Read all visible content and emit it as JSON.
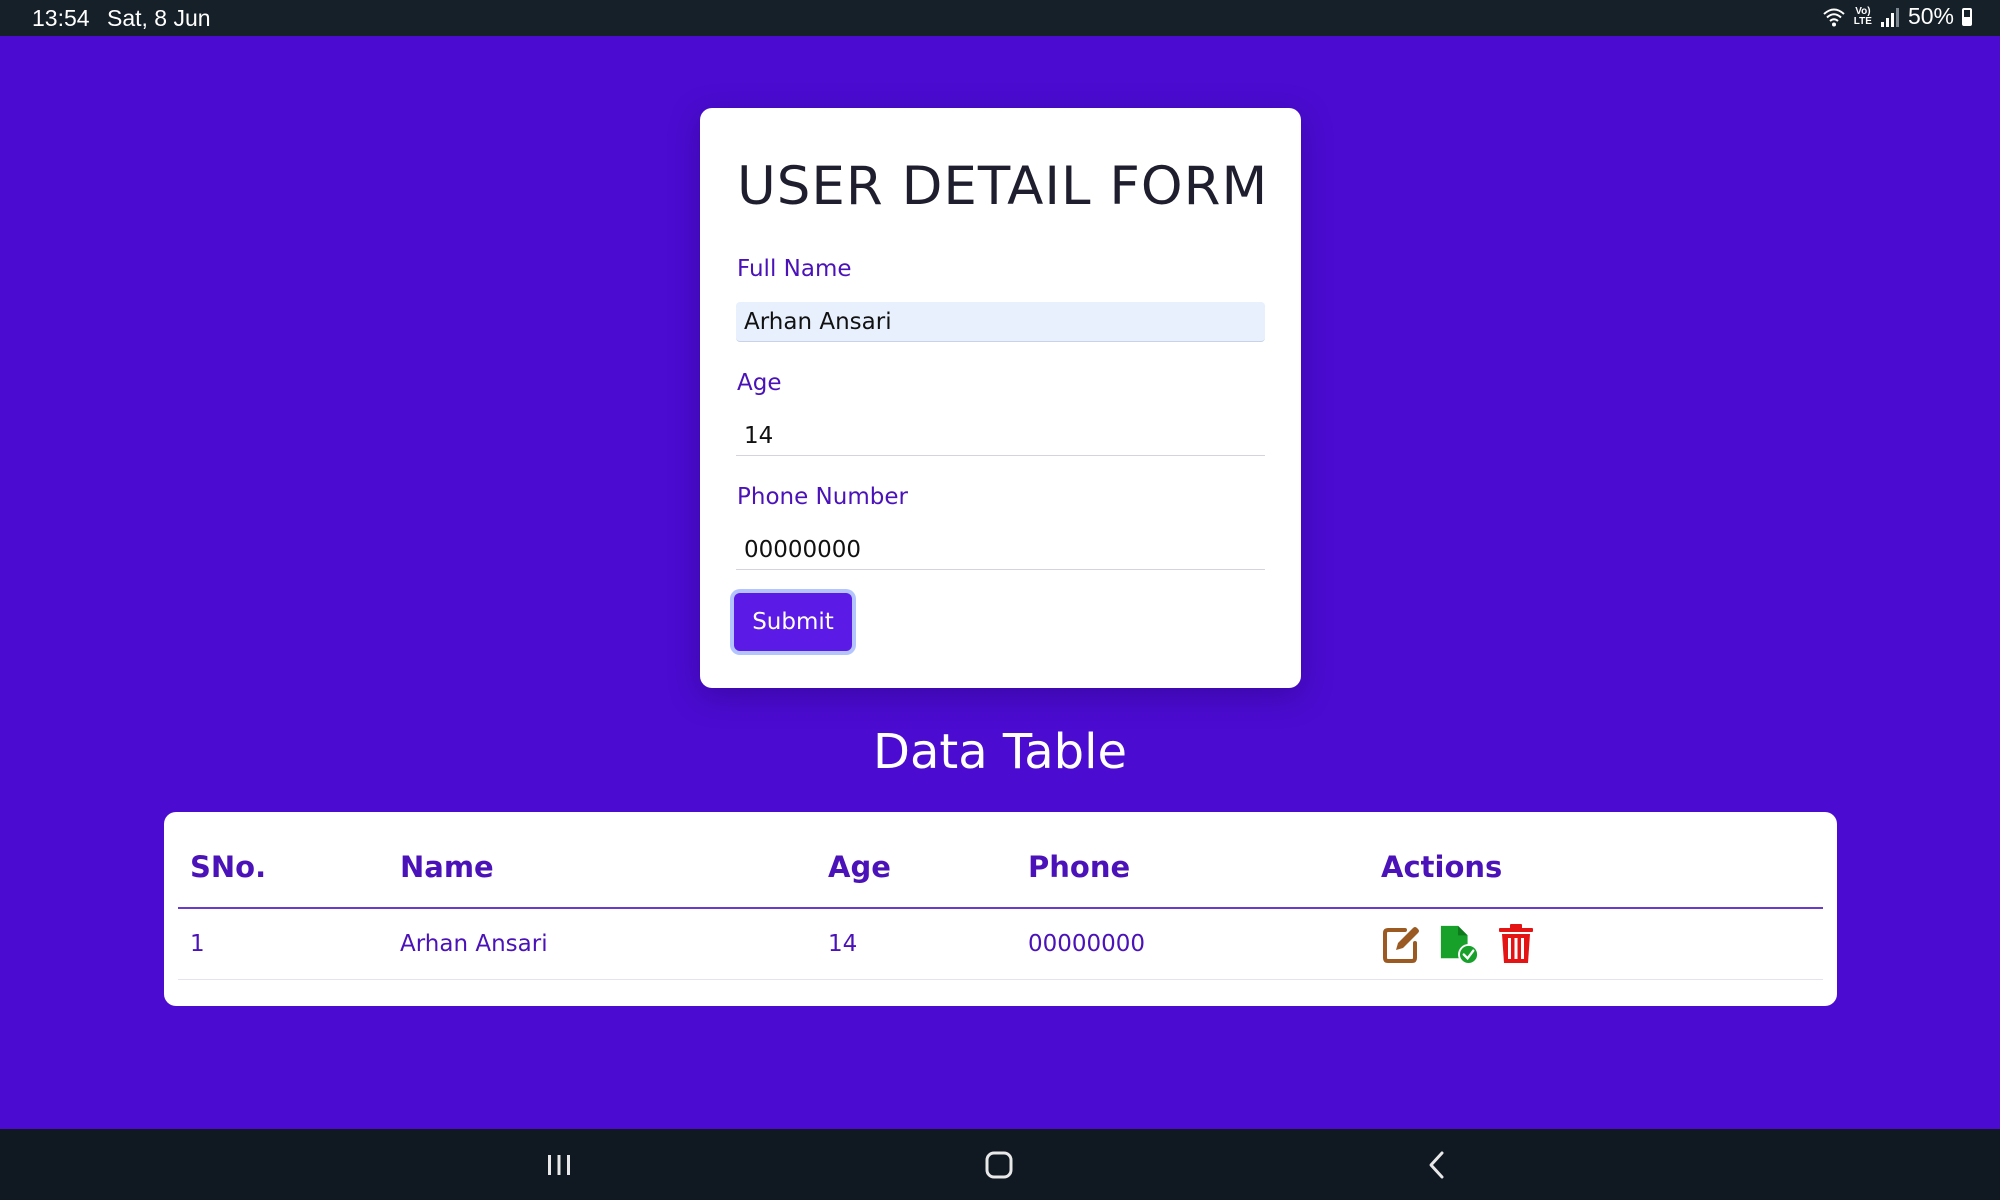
{
  "status_bar": {
    "time": "13:54",
    "date": "Sat, 8 Jun",
    "lte_label_top": "Vo)",
    "lte_label_bottom": "LTE",
    "battery": "50%"
  },
  "form": {
    "title": "USER DETAIL FORM",
    "fields": [
      {
        "label": "Full Name",
        "value": "Arhan Ansari"
      },
      {
        "label": "Age",
        "value": "14"
      },
      {
        "label": "Phone Number",
        "value": "00000000"
      }
    ],
    "submit_label": "Submit"
  },
  "table": {
    "title": "Data Table",
    "headers": [
      "SNo.",
      "Name",
      "Age",
      "Phone",
      "Actions"
    ],
    "rows": [
      {
        "sno": "1",
        "name": "Arhan Ansari",
        "age": "14",
        "phone": "00000000"
      }
    ]
  },
  "colors": {
    "background": "#4b0bd1",
    "accent": "#5b1ae6",
    "label": "#4a12b8",
    "edit_icon": "#9a5a22",
    "save_icon": "#17a02a",
    "delete_icon": "#e51414"
  },
  "icons": {
    "actions": [
      "edit-icon",
      "file-check-icon",
      "trash-icon"
    ],
    "navigation": [
      "recent-apps-icon",
      "home-icon",
      "back-icon"
    ]
  }
}
